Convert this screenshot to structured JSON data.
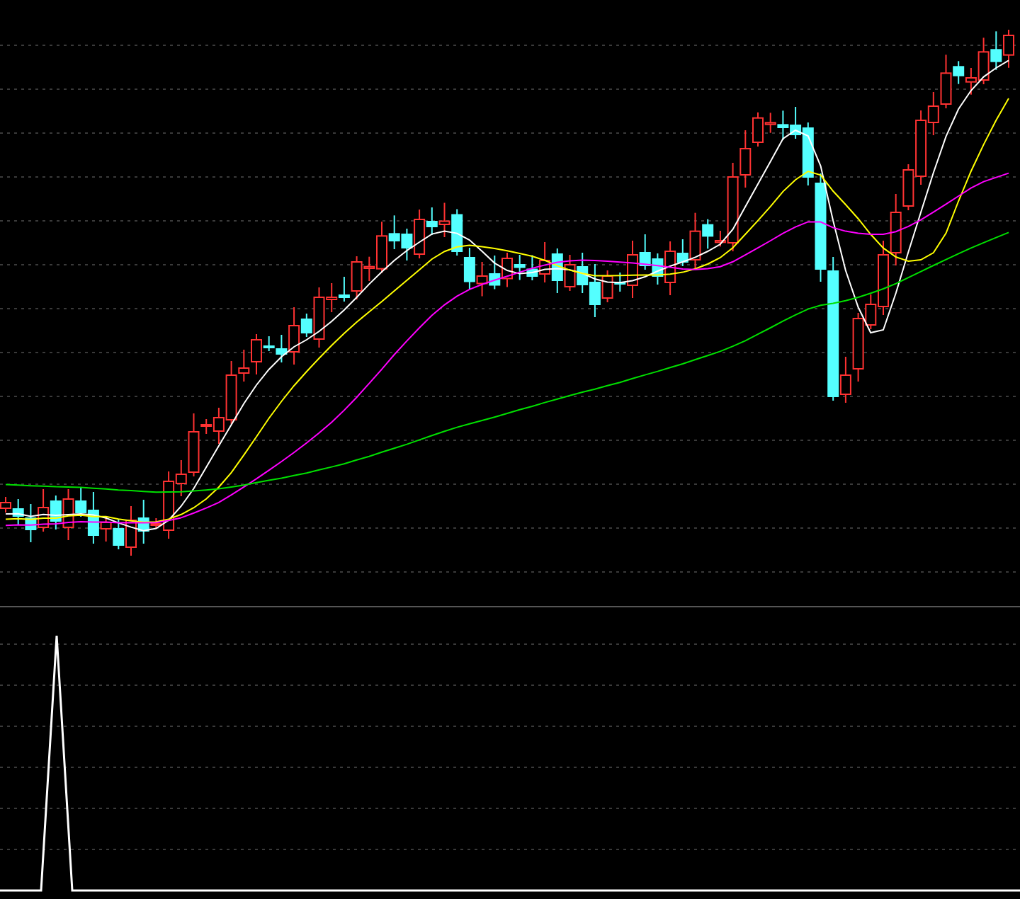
{
  "panels": [
    {
      "kind": "candlestick"
    },
    {
      "kind": "indicator"
    }
  ]
}
